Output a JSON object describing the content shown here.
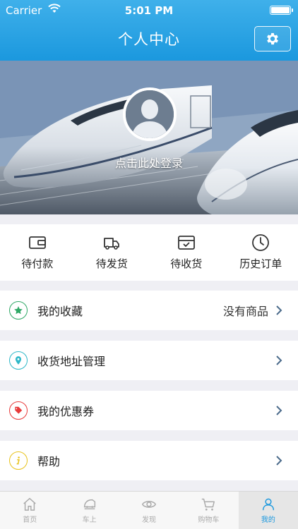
{
  "status_bar": {
    "carrier": "Carrier",
    "time": "5:01 PM"
  },
  "nav": {
    "title": "个人中心",
    "settings_icon": "gear-icon"
  },
  "profile": {
    "login_prompt": "点击此处登录",
    "avatar_icon": "user-avatar-icon"
  },
  "orders": [
    {
      "label": "待付款",
      "icon": "wallet-icon"
    },
    {
      "label": "待发货",
      "icon": "truck-icon"
    },
    {
      "label": "待收货",
      "icon": "inbox-icon"
    },
    {
      "label": "历史订单",
      "icon": "clock-icon"
    }
  ],
  "menu": [
    {
      "label": "我的收藏",
      "value": "没有商品",
      "icon": "star-icon",
      "color": "#2fa866"
    },
    {
      "label": "收货地址管理",
      "value": "",
      "icon": "location-pin-icon",
      "color": "#2eb8c8"
    },
    {
      "label": "我的优惠券",
      "value": "",
      "icon": "tag-icon",
      "color": "#e83a3a"
    },
    {
      "label": "帮助",
      "value": "",
      "icon": "info-icon",
      "color": "#e8c21a"
    }
  ],
  "tabs": [
    {
      "label": "首页",
      "icon": "home-icon",
      "active": false
    },
    {
      "label": "车上",
      "icon": "train-icon",
      "active": false
    },
    {
      "label": "发现",
      "icon": "eye-icon",
      "active": false
    },
    {
      "label": "购物车",
      "icon": "cart-icon",
      "active": false
    },
    {
      "label": "我的",
      "icon": "person-icon",
      "active": true
    }
  ],
  "colors": {
    "header": "#1b98de",
    "accent": "#1b98de",
    "background": "#efeff4"
  }
}
